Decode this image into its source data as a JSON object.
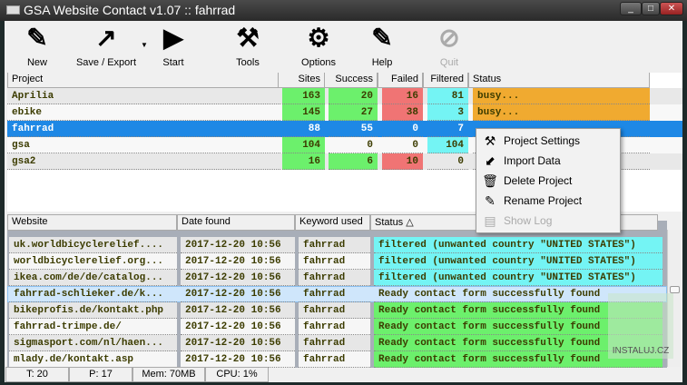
{
  "window": {
    "title": "GSA Website Contact v1.07 :: fahrrad",
    "buttons": [
      "_",
      "□",
      "✕"
    ]
  },
  "toolbar": [
    {
      "label": "New",
      "icon": "edit-icon",
      "glyph": "✎"
    },
    {
      "label": "Save / Export",
      "icon": "share-icon",
      "glyph": "↗"
    },
    {
      "label": "Start",
      "icon": "play-icon",
      "glyph": "▶"
    },
    {
      "label": "Tools",
      "icon": "tools-icon",
      "glyph": "⚒"
    },
    {
      "label": "Options",
      "icon": "gear-icon",
      "glyph": "⚙"
    },
    {
      "label": "Help",
      "icon": "help-edit-icon",
      "glyph": "✎"
    },
    {
      "label": "Quit",
      "icon": "quit-icon",
      "glyph": "⊘"
    }
  ],
  "projects": {
    "columns": [
      "Project",
      "Sites",
      "Success",
      "Failed",
      "Filtered",
      "Status"
    ],
    "rows": [
      {
        "name": "Aprilia",
        "sites": "163",
        "success": "20",
        "failed": "16",
        "filtered": "81",
        "status": "busy..."
      },
      {
        "name": "ebike",
        "sites": "145",
        "success": "27",
        "failed": "38",
        "filtered": "3",
        "status": "busy..."
      },
      {
        "name": "fahrrad",
        "sites": "88",
        "success": "55",
        "failed": "0",
        "filtered": "7",
        "status": ""
      },
      {
        "name": "gsa",
        "sites": "104",
        "success": "0",
        "failed": "0",
        "filtered": "104",
        "status": ""
      },
      {
        "name": "gsa2",
        "sites": "16",
        "success": "6",
        "failed": "10",
        "filtered": "0",
        "status": ""
      }
    ],
    "selected": "fahrrad"
  },
  "context_menu": [
    {
      "label": "Project Settings",
      "icon": "tools-icon",
      "glyph": "⚒",
      "enabled": true
    },
    {
      "label": "Import Data",
      "icon": "import-icon",
      "glyph": "⬋",
      "enabled": true
    },
    {
      "label": "Delete Project",
      "icon": "trash-icon",
      "glyph": "🗑",
      "enabled": true
    },
    {
      "label": "Rename Project",
      "icon": "rename-icon",
      "glyph": "✎",
      "enabled": true
    },
    {
      "label": "Show Log",
      "icon": "log-icon",
      "glyph": "▤",
      "enabled": false
    }
  ],
  "results": {
    "columns": [
      "Website",
      "Date found",
      "Keyword used",
      "Status △"
    ],
    "rows": [
      {
        "site": "uk.worldbicyclerelief....",
        "date": "2017-12-20 10:56",
        "kw": "fahrrad",
        "status": "filtered (unwanted country \"UNITED STATES\")",
        "type": "filtered"
      },
      {
        "site": "worldbicyclerelief.org...",
        "date": "2017-12-20 10:56",
        "kw": "fahrrad",
        "status": "filtered (unwanted country \"UNITED STATES\")",
        "type": "filtered"
      },
      {
        "site": "ikea.com/de/de/catalog...",
        "date": "2017-12-20 10:56",
        "kw": "fahrrad",
        "status": "filtered (unwanted country \"UNITED STATES\")",
        "type": "filtered"
      },
      {
        "site": "fahrrad-schlieker.de/k...",
        "date": "2017-12-20 10:56",
        "kw": "fahrrad",
        "status": "Ready contact form successfully found",
        "type": "selected"
      },
      {
        "site": "bikeprofis.de/kontakt.php",
        "date": "2017-12-20 10:56",
        "kw": "fahrrad",
        "status": "Ready contact form successfully found",
        "type": "success"
      },
      {
        "site": "fahrrad-trimpe.de/",
        "date": "2017-12-20 10:56",
        "kw": "fahrrad",
        "status": "Ready contact form successfully found",
        "type": "success"
      },
      {
        "site": "sigmasport.com/nl/haen...",
        "date": "2017-12-20 10:56",
        "kw": "fahrrad",
        "status": "Ready contact form successfully found",
        "type": "success"
      },
      {
        "site": "mlady.de/kontakt.asp",
        "date": "2017-12-20 10:56",
        "kw": "fahrrad",
        "status": "Ready contact form successfully found",
        "type": "success"
      }
    ]
  },
  "statusbar": [
    "T: 20",
    "P: 17",
    "Mem: 70MB",
    "CPU: 1%"
  ],
  "watermark": "INSTALUJ.CZ",
  "colors": {
    "green": "#6cf06c",
    "red": "#f07474",
    "cyan": "#74f4f4",
    "orange": "#f0aa30",
    "selected": "#1e88e5"
  }
}
